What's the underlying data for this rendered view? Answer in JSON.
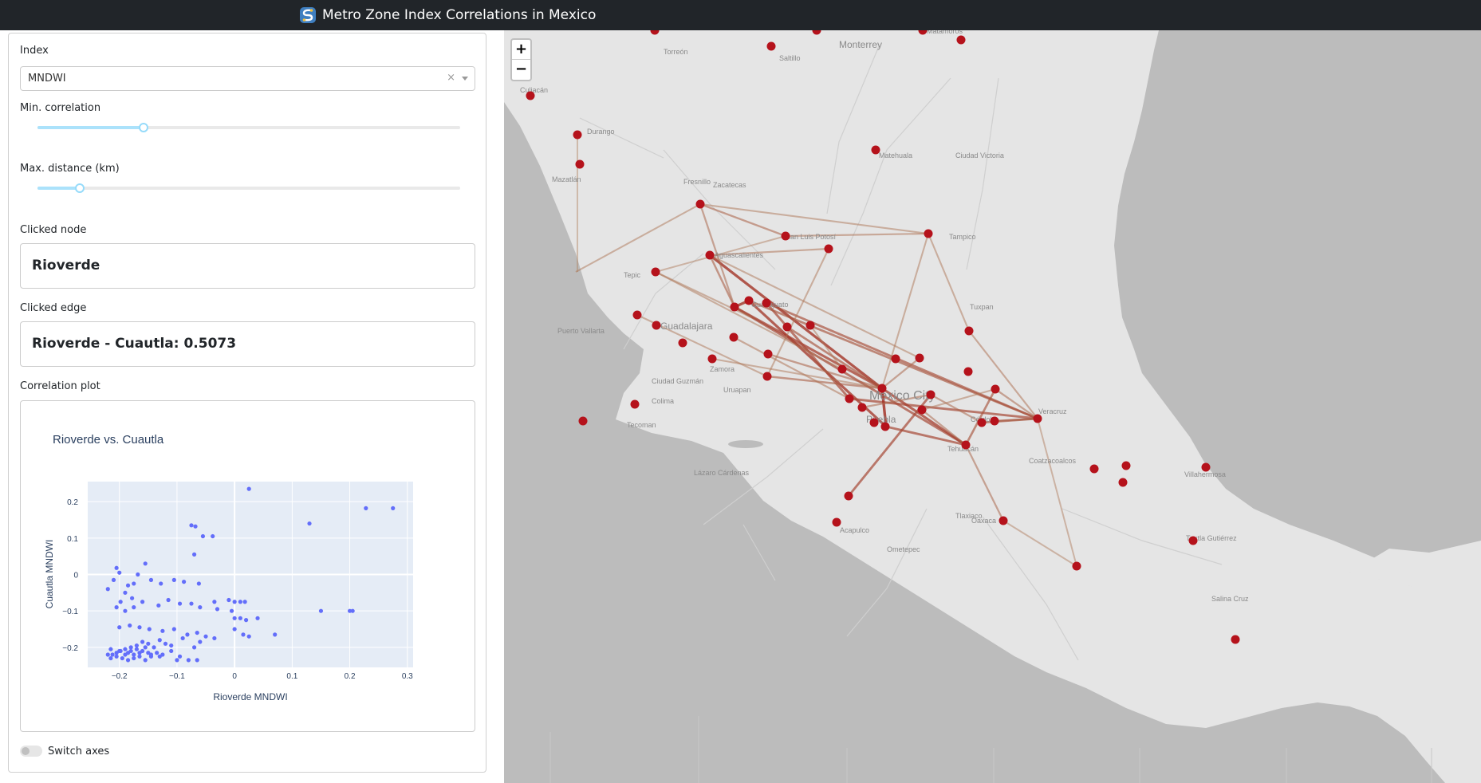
{
  "header": {
    "title": "Metro Zone Index Correlations in Mexico",
    "logo_icon": "app-logo-icon"
  },
  "controls": {
    "index_label": "Index",
    "index_value": "MNDWI",
    "clear_glyph": "×",
    "min_corr_label": "Min. correlation",
    "min_corr_value": 0.25,
    "max_dist_label": "Max. distance (km)",
    "max_dist_value": 0.1,
    "clicked_node_label": "Clicked node",
    "clicked_node_value": "Rioverde",
    "clicked_edge_label": "Clicked edge",
    "clicked_edge_value": "Rioverde - Cuautla: 0.5073",
    "corr_plot_label": "Correlation plot",
    "switch_axes_label": "Switch axes"
  },
  "chart_data": {
    "type": "scatter",
    "title": "Rioverde vs. Cuautla",
    "xlabel": "Rioverde MNDWI",
    "ylabel": "Cuautla MNDWI",
    "xlim": [
      -0.255,
      0.31
    ],
    "ylim": [
      -0.255,
      0.255
    ],
    "xticks": [
      "−0.2",
      "−0.1",
      "0",
      "0.1",
      "0.2",
      "0.3"
    ],
    "xtick_values": [
      -0.2,
      -0.1,
      0,
      0.1,
      0.2,
      0.3
    ],
    "yticks": [
      "0.2",
      "0.1",
      "0",
      "−0.1",
      "−0.2"
    ],
    "ytick_values": [
      0.2,
      0.1,
      0,
      -0.1,
      -0.2
    ],
    "marker_color": "#636efa",
    "plot_bg": "#e5ecf6",
    "series": [
      {
        "x": [
          0.025,
          -0.075,
          -0.068,
          0.13,
          0.228,
          0.275,
          -0.055,
          -0.038,
          -0.07,
          -0.205,
          -0.2,
          -0.168,
          -0.155,
          -0.185,
          -0.175,
          -0.21,
          -0.22,
          -0.19,
          -0.145,
          -0.128,
          -0.105,
          -0.088,
          -0.062,
          -0.198,
          -0.178,
          -0.16,
          -0.132,
          -0.115,
          -0.095,
          -0.075,
          -0.06,
          -0.175,
          -0.19,
          -0.205,
          -0.035,
          -0.01,
          0.0,
          0.01,
          0.018,
          0.15,
          0.2,
          0.205,
          -0.03,
          -0.005,
          0.0,
          0.01,
          0.02,
          0.04,
          -0.2,
          -0.182,
          -0.165,
          -0.148,
          -0.125,
          -0.105,
          -0.082,
          -0.065,
          -0.05,
          -0.035,
          0.0,
          0.015,
          0.025,
          0.07,
          -0.215,
          -0.2,
          -0.19,
          -0.18,
          -0.17,
          -0.16,
          -0.15,
          -0.14,
          -0.13,
          -0.12,
          -0.11,
          -0.09,
          -0.06,
          -0.22,
          -0.212,
          -0.205,
          -0.198,
          -0.19,
          -0.185,
          -0.18,
          -0.175,
          -0.17,
          -0.165,
          -0.16,
          -0.155,
          -0.15,
          -0.145,
          -0.135,
          -0.125,
          -0.11,
          -0.095,
          -0.07,
          -0.215,
          -0.205,
          -0.195,
          -0.185,
          -0.175,
          -0.165,
          -0.155,
          -0.145,
          -0.13,
          -0.1,
          -0.08,
          -0.065
        ],
        "y": [
          0.235,
          0.135,
          0.132,
          0.14,
          0.182,
          0.182,
          0.105,
          0.105,
          0.055,
          0.018,
          0.005,
          0.0,
          0.03,
          -0.03,
          -0.025,
          -0.015,
          -0.04,
          -0.05,
          -0.015,
          -0.025,
          -0.015,
          -0.02,
          -0.025,
          -0.075,
          -0.065,
          -0.075,
          -0.085,
          -0.07,
          -0.08,
          -0.08,
          -0.09,
          -0.09,
          -0.1,
          -0.09,
          -0.075,
          -0.07,
          -0.075,
          -0.075,
          -0.075,
          -0.1,
          -0.1,
          -0.1,
          -0.095,
          -0.1,
          -0.12,
          -0.12,
          -0.125,
          -0.12,
          -0.145,
          -0.14,
          -0.145,
          -0.15,
          -0.155,
          -0.15,
          -0.165,
          -0.16,
          -0.17,
          -0.175,
          -0.15,
          -0.165,
          -0.17,
          -0.165,
          -0.205,
          -0.21,
          -0.205,
          -0.2,
          -0.195,
          -0.185,
          -0.19,
          -0.2,
          -0.18,
          -0.19,
          -0.195,
          -0.175,
          -0.185,
          -0.22,
          -0.22,
          -0.215,
          -0.21,
          -0.22,
          -0.215,
          -0.21,
          -0.22,
          -0.205,
          -0.215,
          -0.21,
          -0.2,
          -0.215,
          -0.225,
          -0.215,
          -0.22,
          -0.21,
          -0.225,
          -0.2,
          -0.23,
          -0.225,
          -0.23,
          -0.235,
          -0.23,
          -0.225,
          -0.235,
          -0.22,
          -0.225,
          -0.235,
          -0.235,
          -0.235
        ]
      }
    ]
  },
  "map": {
    "zoom_in": "+",
    "zoom_out": "−",
    "node_color": "#b5121b",
    "land_color": "#e5e5e5",
    "sea_color": "#bcbcbc",
    "place_labels": [
      "Monterrey",
      "Torreón",
      "Saltillo",
      "Matamoros",
      "Culiacán",
      "Durango",
      "Mazatlán",
      "Ciudad Victoria",
      "Matehuala",
      "Fresnillo",
      "Zacatecas",
      "Tampico",
      "San Luis Potosí",
      "Aguascalientes",
      "Tepic",
      "Guanajuato",
      "Tuxpan",
      "Puerto Vallarta",
      "Guadalajara",
      "Zamora",
      "Mexico City",
      "Ciudad Guzmán",
      "Uruapan",
      "Colima",
      "Puebla",
      "Veracruz",
      "Tecoman",
      "Córdoba",
      "Tehuacán",
      "Coatzacoalcos",
      "Villahermosa",
      "Lázaro Cárdenas",
      "Tlaxiaco",
      "Oaxaca",
      "Acapulco",
      "Ometepec",
      "Tuxtla Gutiérrez",
      "Salina Cruz"
    ]
  }
}
